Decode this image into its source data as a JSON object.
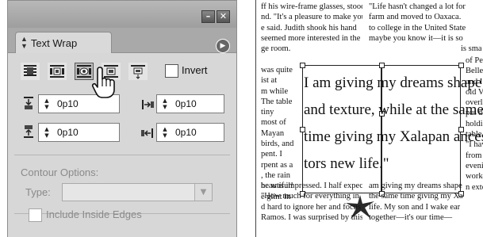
{
  "panel": {
    "title": "Text Wrap",
    "window_controls": {
      "minimize": "–",
      "close": "✕"
    },
    "wrap_modes": [
      {
        "name": "No text wrap",
        "icon": "no-wrap-icon"
      },
      {
        "name": "Wrap around bounding box",
        "icon": "wrap-bounding-box-icon"
      },
      {
        "name": "Wrap around object shape",
        "icon": "wrap-object-shape-icon",
        "selected": true
      },
      {
        "name": "Jump object",
        "icon": "jump-object-icon"
      },
      {
        "name": "Jump to next column",
        "icon": "jump-next-column-icon"
      }
    ],
    "invert_label": "Invert",
    "invert_checked": false,
    "offsets": {
      "top": "0p10",
      "left": "0p10",
      "bottom": "0p10",
      "right": "0p10"
    },
    "contour_options_title": "Contour Options:",
    "type_label": "Type:",
    "type_value": "",
    "include_inside_edges_label": "Include Inside Edges",
    "include_inside_edges_checked": false
  },
  "layout": {
    "top_left_lines": [
      "ff his wire-frame glasses, stood,",
      "nd. \"It's a pleasure to make your",
      "e said. Judith shook his hand",
      "seemed more interested in the art",
      "ge room."
    ],
    "top_right_lines": [
      "\"Life hasn't changed a lot for",
      "farm and moved to Oaxaca.",
      "to college in the United State",
      "maybe you know it—it is so",
      "is small"
    ],
    "side_left_lines": [
      "was quite",
      "ist at",
      "m while",
      "The table",
      "tiny",
      "most of",
      "Mayan",
      "birds, and",
      "pent. I",
      "rpent as a",
      ", the rain",
      "beautiful!",
      "e glint in"
    ],
    "side_right_lines": [
      "of Penn",
      "Bellefo",
      "and I h",
      "old Vi",
      "overloo",
      "put do",
      "holdin",
      "table.",
      "\"I hav",
      "from c",
      "evenin",
      "work—",
      "n exte"
    ],
    "pull_quote_lines": [
      "I am giving my dreams shape",
      "and texture, while at the same",
      "time giving my Xalapan ances-",
      "tors new life.\""
    ],
    "bottom_left_lines": [
      "he was impressed. I half expected",
      "\"How much for everything in",
      "d hard to ignore her and focus",
      "Ramos. I was surprised by this"
    ],
    "bottom_right_lines": [
      "am giving my dreams shape",
      "the same time giving my Xa",
      "life. My son and I wake ear",
      "together—it's our time—"
    ]
  }
}
